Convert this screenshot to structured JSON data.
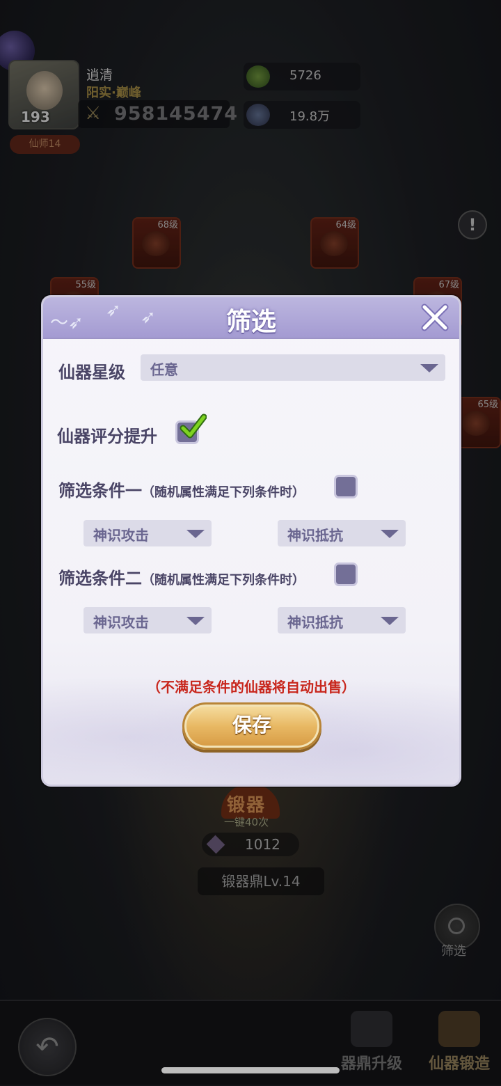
{
  "player": {
    "name": "逍清",
    "title": "阳实·巅峰",
    "level": "193",
    "power": "958145474",
    "rank_badge": "仙师14"
  },
  "resources": [
    {
      "icon": "green-coin-icon",
      "value": "5726"
    },
    {
      "icon": "star-shard-icon",
      "value": "19.8万"
    }
  ],
  "equipment_slots": [
    {
      "level": "68级"
    },
    {
      "level": "64级"
    },
    {
      "level": "55级"
    },
    {
      "level": "67级"
    },
    {
      "level": "65级"
    }
  ],
  "forge": {
    "title": "锻器",
    "subtitle": "一键40次",
    "cost": "1012",
    "level_label": "锻器鼎Lv.14"
  },
  "filter_fab_label": "筛选",
  "bottom_tabs": [
    {
      "label": "器鼎升级"
    },
    {
      "label": "仙器锻造"
    }
  ],
  "dialog": {
    "title": "筛选",
    "star_level": {
      "label": "仙器星级",
      "selected": "任意"
    },
    "score_up": {
      "label": "仙器评分提升",
      "checked": true
    },
    "condition1": {
      "label": "筛选条件一",
      "note": "（随机属性满足下列条件时）",
      "checked": false,
      "select_a": "神识攻击",
      "select_b": "神识抵抗"
    },
    "condition2": {
      "label": "筛选条件二",
      "note": "（随机属性满足下列条件时）",
      "checked": false,
      "select_a": "神识攻击",
      "select_b": "神识抵抗"
    },
    "warning": "（不满足条件的仙器将自动出售）",
    "save_label": "保存"
  },
  "colors": {
    "dialog_header": "#a49bd2",
    "warning_text": "#c8261c",
    "save_button": "#e8b964",
    "check_mark": "#7ed321"
  }
}
